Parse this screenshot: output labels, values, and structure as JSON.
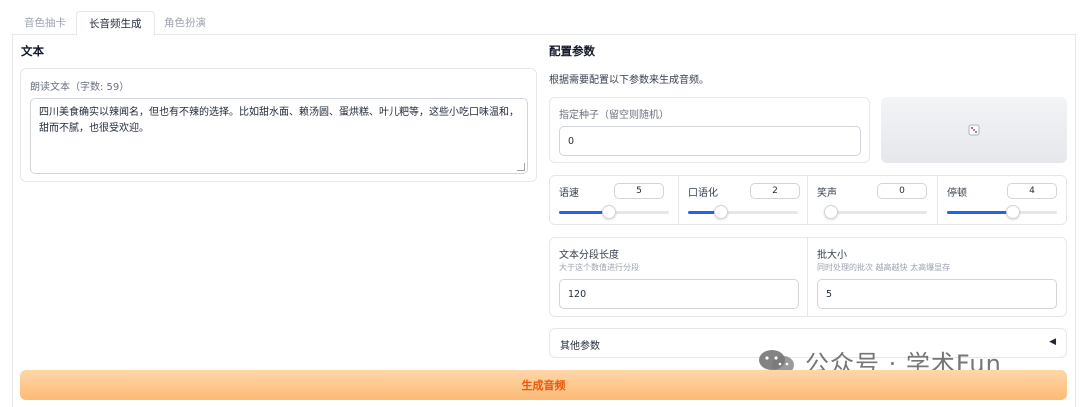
{
  "tabs": [
    {
      "label": "音色抽卡",
      "active": false
    },
    {
      "label": "长音频生成",
      "active": true
    },
    {
      "label": "角色扮演",
      "active": false
    }
  ],
  "left": {
    "title": "文本",
    "text_label": "朗读文本（字数: 59）",
    "text_value": "四川美食确实以辣闻名，但也有不辣的选择。比如甜水面、赖汤圆、蛋烘糕、叶儿粑等，这些小吃口味温和，甜而不腻，也很受欢迎。"
  },
  "right": {
    "title": "配置参数",
    "hint": "根据需要配置以下参数来生成音频。",
    "seed_label": "指定种子（留空则随机）",
    "seed_value": "0",
    "dice_icon": "dice-icon",
    "sliders": [
      {
        "label": "语速",
        "value": "5",
        "fraction": 0.45
      },
      {
        "label": "口语化",
        "value": "2",
        "fraction": 0.3
      },
      {
        "label": "笑声",
        "value": "0",
        "fraction": 0.0
      },
      {
        "label": "停顿",
        "value": "4",
        "fraction": 0.6
      }
    ],
    "segment_label": "文本分段长度",
    "segment_sub": "大于这个数值进行分段",
    "segment_value": "120",
    "batch_label": "批大小",
    "batch_sub": "同时处理的批次 越高越快 太高爆显存",
    "batch_value": "5",
    "other_params": "其他参数",
    "other_arrow": "◀"
  },
  "generate_label": "生成音频",
  "watermark": "公众号 · 学术Fun",
  "colors": {
    "accent": "#2563eb",
    "generate": "#ea580c"
  }
}
